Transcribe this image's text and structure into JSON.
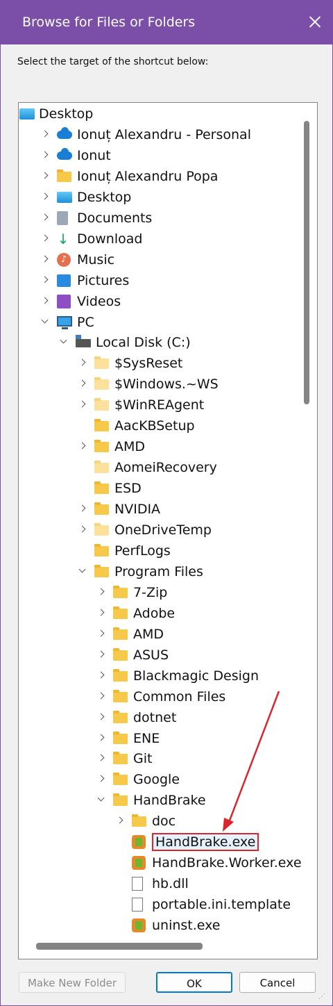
{
  "window": {
    "title": "Browse for Files or Folders"
  },
  "instruction": "Select the target of the shortcut below:",
  "tree": [
    {
      "label": "Desktop",
      "icon": "desktop-icon",
      "level": 0,
      "expander": "none"
    },
    {
      "label": "Ionuț Alexandru - Personal",
      "icon": "onedrive-icon",
      "level": 1,
      "expander": "collapsed"
    },
    {
      "label": "Ionut",
      "icon": "onedrive-icon",
      "level": 1,
      "expander": "collapsed"
    },
    {
      "label": "Ionuț Alexandru Popa",
      "icon": "user-folder-icon",
      "level": 1,
      "expander": "collapsed"
    },
    {
      "label": "Desktop",
      "icon": "desktop-icon",
      "level": 1,
      "expander": "collapsed"
    },
    {
      "label": "Documents",
      "icon": "documents-icon",
      "level": 1,
      "expander": "collapsed"
    },
    {
      "label": "Download",
      "icon": "download-icon",
      "level": 1,
      "expander": "collapsed"
    },
    {
      "label": "Music",
      "icon": "music-icon",
      "level": 1,
      "expander": "collapsed"
    },
    {
      "label": "Pictures",
      "icon": "pictures-icon",
      "level": 1,
      "expander": "collapsed"
    },
    {
      "label": "Videos",
      "icon": "videos-icon",
      "level": 1,
      "expander": "collapsed"
    },
    {
      "label": "PC",
      "icon": "pc-icon",
      "level": 1,
      "expander": "expanded"
    },
    {
      "label": "Local Disk (C:)",
      "icon": "local-disk-icon",
      "level": 2,
      "expander": "expanded"
    },
    {
      "label": "$SysReset",
      "icon": "folder-icon",
      "level": 3,
      "expander": "collapsed",
      "light": true
    },
    {
      "label": "$Windows.~WS",
      "icon": "folder-icon",
      "level": 3,
      "expander": "collapsed",
      "light": true
    },
    {
      "label": "$WinREAgent",
      "icon": "folder-icon",
      "level": 3,
      "expander": "collapsed",
      "light": true
    },
    {
      "label": "AacKBSetup",
      "icon": "folder-icon",
      "level": 3,
      "expander": "none"
    },
    {
      "label": "AMD",
      "icon": "folder-icon",
      "level": 3,
      "expander": "collapsed"
    },
    {
      "label": "AomeiRecovery",
      "icon": "folder-icon",
      "level": 3,
      "expander": "none",
      "light": true
    },
    {
      "label": "ESD",
      "icon": "folder-icon",
      "level": 3,
      "expander": "none"
    },
    {
      "label": "NVIDIA",
      "icon": "folder-icon",
      "level": 3,
      "expander": "collapsed"
    },
    {
      "label": "OneDriveTemp",
      "icon": "folder-icon",
      "level": 3,
      "expander": "collapsed",
      "light": true
    },
    {
      "label": "PerfLogs",
      "icon": "folder-icon",
      "level": 3,
      "expander": "none"
    },
    {
      "label": "Program Files",
      "icon": "folder-icon",
      "level": 3,
      "expander": "expanded"
    },
    {
      "label": "7-Zip",
      "icon": "folder-icon",
      "level": 4,
      "expander": "collapsed"
    },
    {
      "label": "Adobe",
      "icon": "folder-icon",
      "level": 4,
      "expander": "collapsed"
    },
    {
      "label": "AMD",
      "icon": "folder-icon",
      "level": 4,
      "expander": "collapsed"
    },
    {
      "label": "ASUS",
      "icon": "folder-icon",
      "level": 4,
      "expander": "collapsed"
    },
    {
      "label": "Blackmagic Design",
      "icon": "folder-icon",
      "level": 4,
      "expander": "collapsed"
    },
    {
      "label": "Common Files",
      "icon": "folder-icon",
      "level": 4,
      "expander": "collapsed"
    },
    {
      "label": "dotnet",
      "icon": "folder-icon",
      "level": 4,
      "expander": "collapsed"
    },
    {
      "label": "ENE",
      "icon": "folder-icon",
      "level": 4,
      "expander": "collapsed"
    },
    {
      "label": "Git",
      "icon": "folder-icon",
      "level": 4,
      "expander": "collapsed"
    },
    {
      "label": "Google",
      "icon": "folder-icon",
      "level": 4,
      "expander": "collapsed"
    },
    {
      "label": "HandBrake",
      "icon": "folder-icon",
      "level": 4,
      "expander": "expanded"
    },
    {
      "label": "doc",
      "icon": "folder-icon",
      "level": 5,
      "expander": "collapsed"
    },
    {
      "label": "HandBrake.exe",
      "icon": "handbrake-exe-icon",
      "level": 5,
      "expander": "none",
      "selected": true
    },
    {
      "label": "HandBrake.Worker.exe",
      "icon": "handbrake-exe-icon",
      "level": 5,
      "expander": "none"
    },
    {
      "label": "hb.dll",
      "icon": "dll-file-icon",
      "level": 5,
      "expander": "none"
    },
    {
      "label": "portable.ini.template",
      "icon": "file-icon",
      "level": 5,
      "expander": "none"
    },
    {
      "label": "uninst.exe",
      "icon": "handbrake-exe-icon",
      "level": 5,
      "expander": "none"
    }
  ],
  "buttons": {
    "make_new_folder": "Make New Folder",
    "ok": "OK",
    "cancel": "Cancel"
  },
  "colors": {
    "titlebar": "#7b4fa8",
    "highlight_box": "#d9252b",
    "arrow": "#d9252b",
    "default_button_border": "#0078d4"
  }
}
